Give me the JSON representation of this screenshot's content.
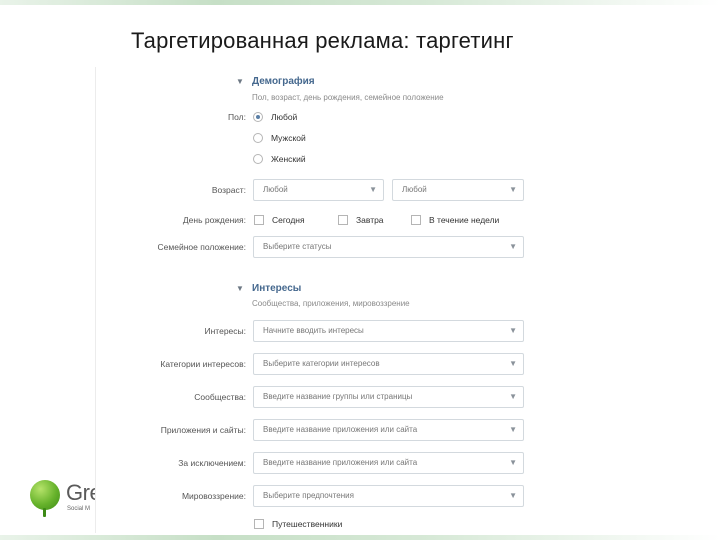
{
  "slide": {
    "title": "Таргетированная реклама: таргетинг",
    "logo": {
      "name": "Gre",
      "sub": "Social M"
    }
  },
  "colors": {
    "accent": "#45688e",
    "border": "#d3d9de",
    "logo_green": "#66b22b"
  },
  "icons": {
    "section_toggle": "triangle-down-icon",
    "dropdown": "chevron-down-icon"
  },
  "demography": {
    "title": "Демография",
    "subtitle": "Пол, возраст, день рождения, семейное положение",
    "gender": {
      "label": "Пол:",
      "options": [
        "Любой",
        "Мужской",
        "Женский"
      ],
      "selected": "Любой"
    },
    "age": {
      "label": "Возраст:",
      "from": "Любой",
      "to": "Любой"
    },
    "birthday": {
      "label": "День рождения:",
      "options": [
        "Сегодня",
        "Завтра",
        "В течение недели"
      ]
    },
    "marital": {
      "label": "Семейное положение:",
      "placeholder": "Выберите статусы"
    }
  },
  "interests": {
    "title": "Интересы",
    "subtitle": "Сообщества, приложения, мировоззрение",
    "rows": [
      {
        "label": "Интересы:",
        "placeholder": "Начните вводить интересы"
      },
      {
        "label": "Категории интересов:",
        "placeholder": "Выберите категории интересов"
      },
      {
        "label": "Сообщества:",
        "placeholder": "Введите название группы или страницы"
      },
      {
        "label": "Приложения и сайты:",
        "placeholder": "Введите название приложения или сайта"
      },
      {
        "label": "За исключением:",
        "placeholder": "Введите название приложения или сайта"
      },
      {
        "label": "Мировоззрение:",
        "placeholder": "Выберите предпочтения"
      }
    ],
    "travelers": "Путешественники"
  }
}
